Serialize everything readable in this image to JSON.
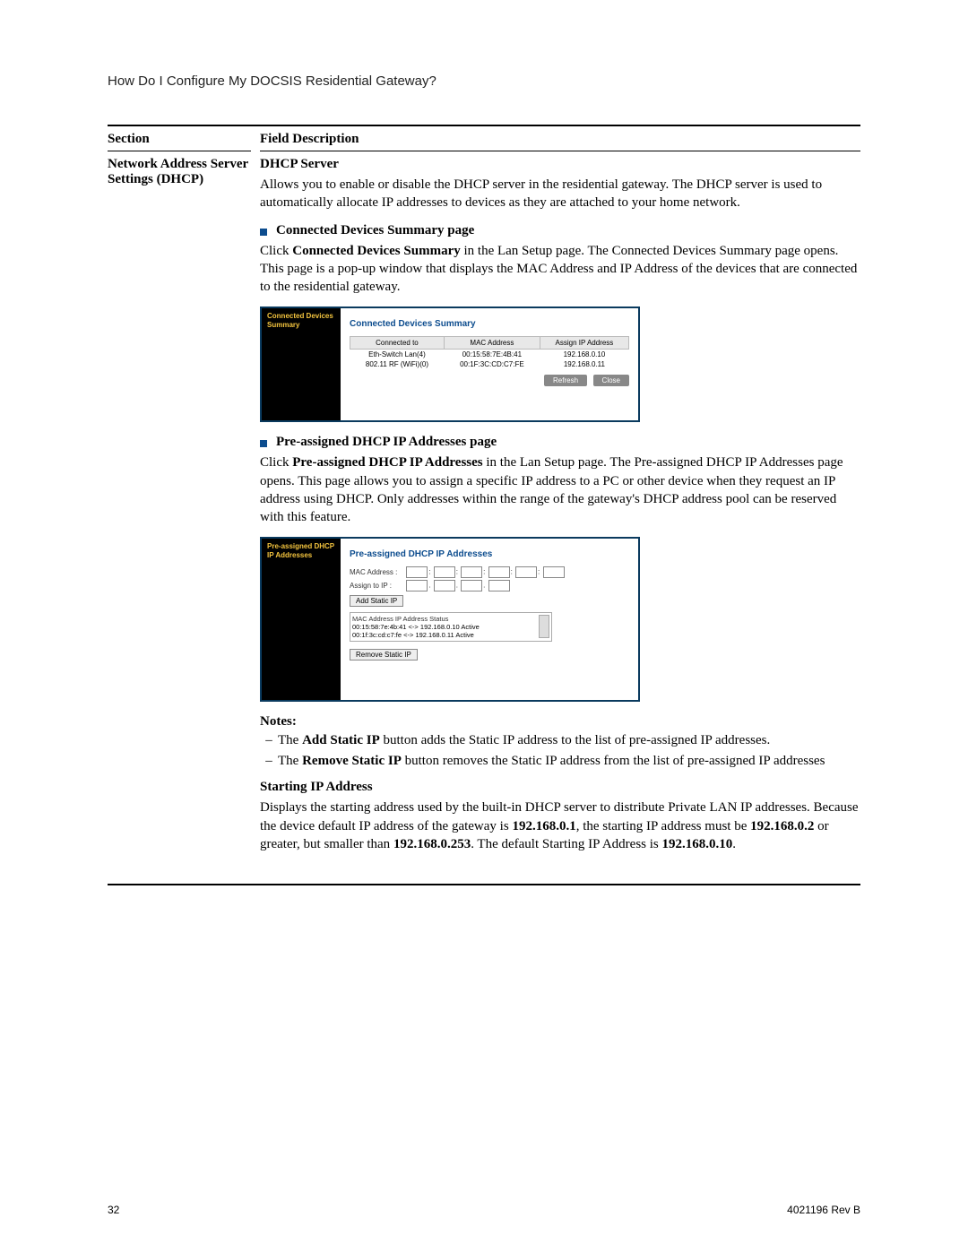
{
  "header": "How Do I Configure My DOCSIS Residential Gateway?",
  "table_headers": {
    "section": "Section",
    "field": "Field Description"
  },
  "section_name": "Network Address Server Settings (DHCP)",
  "dhcp_server": {
    "title": "DHCP Server",
    "desc": "Allows you to enable or disable the DHCP server in the residential gateway. The DHCP server is used to automatically allocate IP addresses to devices as they are attached to your home network."
  },
  "connected": {
    "bullet_title": "Connected Devices Summary page",
    "desc_pre": "Click ",
    "desc_bold": "Connected Devices Summary",
    "desc_post": " in the Lan Setup page. The Connected Devices Summary page opens. This page is a pop-up window that displays the MAC Address and IP Address of the devices that are connected to the residential gateway.",
    "shot": {
      "left_label": "Connected Devices Summary",
      "title": "Connected Devices Summary",
      "cols": [
        "Connected to",
        "MAC Address",
        "Assign IP Address"
      ],
      "rows": [
        [
          "Eth-Switch Lan(4)",
          "00:15:58:7E:4B:41",
          "192.168.0.10"
        ],
        [
          "802.11 RF (WiFi)(0)",
          "00:1F:3C:CD:C7:FE",
          "192.168.0.11"
        ]
      ],
      "refresh": "Refresh",
      "close": "Close"
    }
  },
  "preassigned": {
    "bullet_title": "Pre-assigned DHCP IP Addresses page",
    "desc_pre": "Click ",
    "desc_bold": "Pre-assigned DHCP IP Addresses",
    "desc_post": " in the Lan Setup page. The Pre-assigned DHCP IP Addresses page opens. This page allows you to assign a specific IP address to a PC or other device when they request an IP address using DHCP. Only addresses within the range of the gateway's DHCP address pool can be reserved with this feature.",
    "shot": {
      "left_label": "Pre-assigned DHCP IP Addresses",
      "title": "Pre-assigned DHCP IP Addresses",
      "mac_label": "MAC Address :",
      "assign_label": "Assign to IP :",
      "add_btn": "Add Static IP",
      "list_cols": "MAC Address      IP Address      Status",
      "list_rows": [
        "00:15:58:7e:4b:41 <-> 192.168.0.10    Active",
        "00:1f:3c:cd:c7:fe <-> 192.168.0.11    Active"
      ],
      "remove_btn": "Remove Static IP"
    }
  },
  "notes": {
    "label": "Notes:",
    "items": [
      {
        "pre": "The ",
        "b1": "Add Static IP",
        "post": " button adds the Static IP address to the list of pre-assigned IP addresses."
      },
      {
        "pre": "The ",
        "b1": "Remove Static IP",
        "post": " button removes the Static IP address from the list of pre-assigned IP addresses"
      }
    ]
  },
  "starting": {
    "title": "Starting IP Address",
    "p1": "Displays the starting address used by the built-in DHCP server to distribute Private LAN IP addresses. Because the device default IP address of the gateway is ",
    "b1": "192.168.0.1",
    "p2": ", the starting IP address must be ",
    "b2": "192.168.0.2",
    "p3": " or greater, but smaller than ",
    "b3": "192.168.0.253",
    "p4": ". The default Starting IP Address is ",
    "b4": "192.168.0.10",
    "p5": "."
  },
  "footer": {
    "page": "32",
    "doc": "4021196 Rev B"
  }
}
